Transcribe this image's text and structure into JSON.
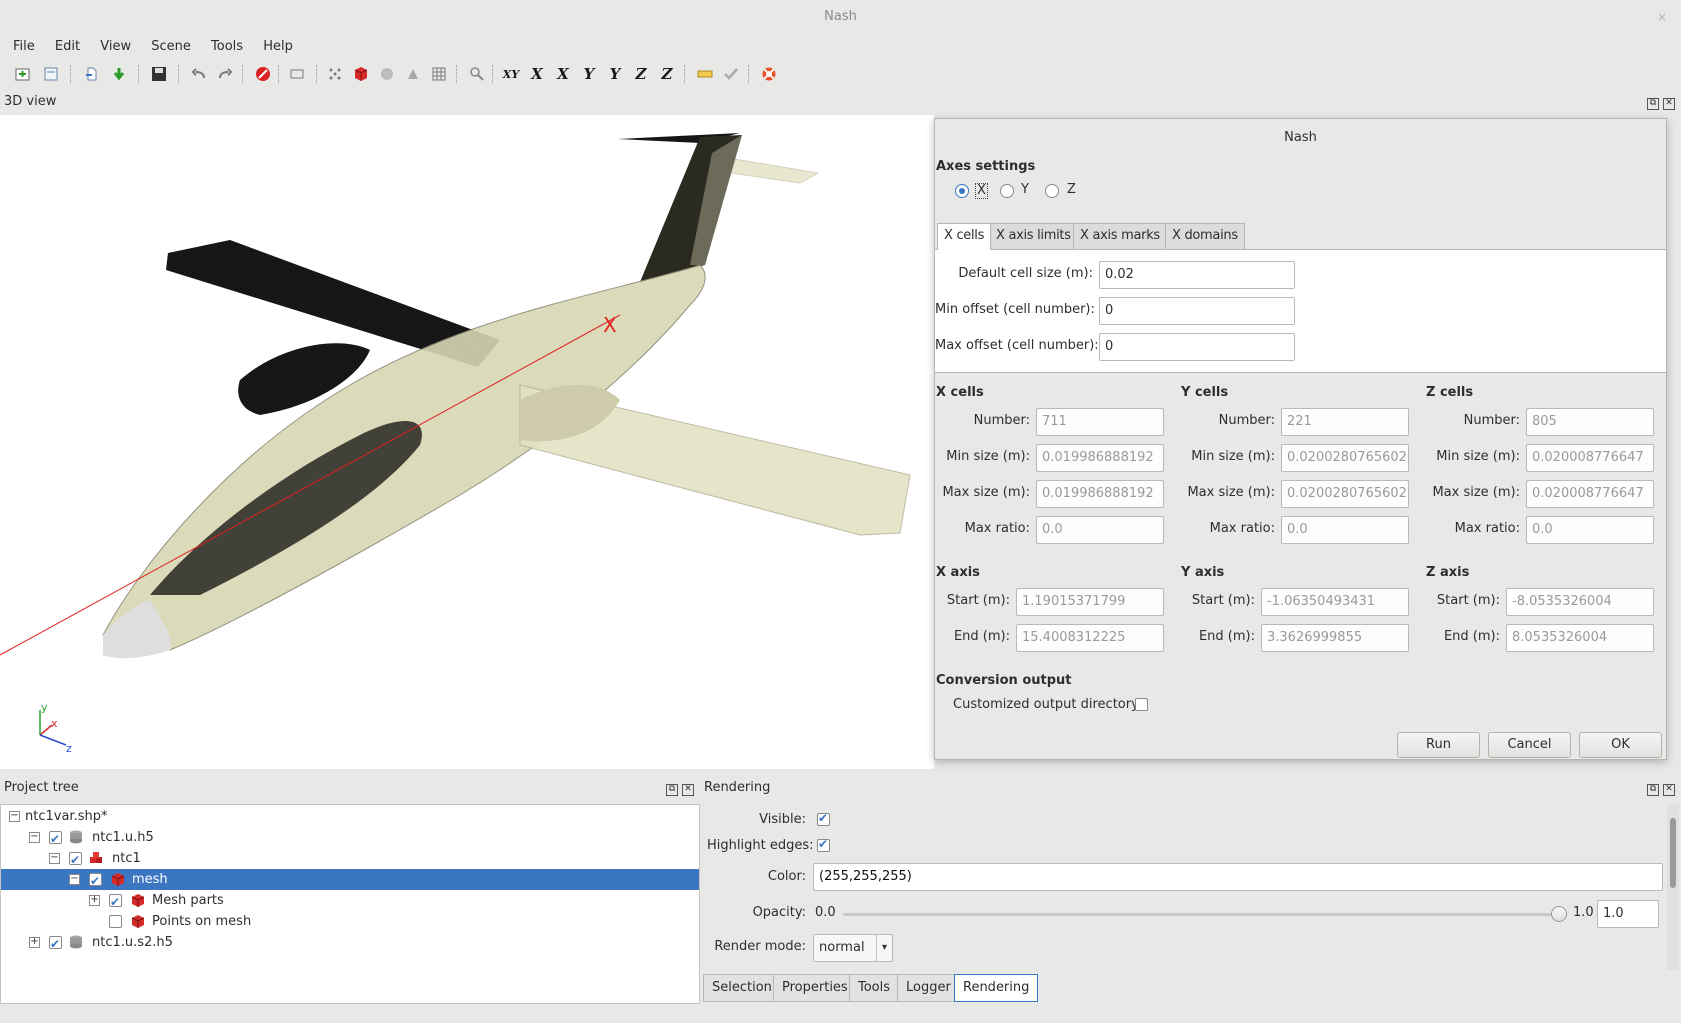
{
  "window": {
    "title": "Nash",
    "close_glyph": "×"
  },
  "menu": [
    "File",
    "Edit",
    "View",
    "Scene",
    "Tools",
    "Help"
  ],
  "toolbar": {
    "axis_buttons": [
      "XY",
      "X",
      "X",
      "Y",
      "Y",
      "Z",
      "Z"
    ]
  },
  "view3d": {
    "title": "3D view",
    "marker_label": "X",
    "triad": {
      "x": "x",
      "y": "y",
      "z": "z"
    }
  },
  "dialog": {
    "title": "Nash",
    "axes_settings_label": "Axes settings",
    "radios": [
      {
        "label": "X",
        "selected": true
      },
      {
        "label": "Y",
        "selected": false
      },
      {
        "label": "Z",
        "selected": false
      }
    ],
    "tabs": [
      "X cells",
      "X axis limits",
      "X axis marks",
      "X domains"
    ],
    "active_tab": "X cells",
    "cell_form": {
      "default_cell_size_label": "Default cell size (m):",
      "default_cell_size_value": "0.02",
      "min_offset_label": "Min offset (cell number):",
      "min_offset_value": "0",
      "max_offset_label": "Max offset (cell number):",
      "max_offset_value": "0"
    },
    "cells": [
      {
        "title": "X cells",
        "number_label": "Number:",
        "number": "711",
        "min_size_label": "Min size (m):",
        "min_size": "0.019986888192",
        "max_size_label": "Max size (m):",
        "max_size": "0.019986888192",
        "max_ratio_label": "Max ratio:",
        "max_ratio": "0.0"
      },
      {
        "title": "Y cells",
        "number_label": "Number:",
        "number": "221",
        "min_size_label": "Min size (m):",
        "min_size": "0.0200280765602",
        "max_size_label": "Max size (m):",
        "max_size": "0.0200280765602",
        "max_ratio_label": "Max ratio:",
        "max_ratio": "0.0"
      },
      {
        "title": "Z cells",
        "number_label": "Number:",
        "number": "805",
        "min_size_label": "Min size (m):",
        "min_size": "0.020008776647",
        "max_size_label": "Max size (m):",
        "max_size": "0.020008776647",
        "max_ratio_label": "Max ratio:",
        "max_ratio": "0.0"
      }
    ],
    "axes": [
      {
        "title": "X axis",
        "start_label": "Start (m):",
        "start": "1.19015371799",
        "end_label": "End (m):",
        "end": "15.4008312225"
      },
      {
        "title": "Y axis",
        "start_label": "Start (m):",
        "start": "-1.06350493431",
        "end_label": "End (m):",
        "end": "3.3626999855"
      },
      {
        "title": "Z axis",
        "start_label": "Start (m):",
        "start": "-8.0535326004",
        "end_label": "End (m):",
        "end": "8.0535326004"
      }
    ],
    "conversion_output_label": "Conversion output",
    "custom_dir_label": "Customized output directory:",
    "custom_dir_checked": false,
    "buttons": {
      "run": "Run",
      "cancel": "Cancel",
      "ok": "OK"
    }
  },
  "project_tree": {
    "title": "Project tree",
    "items": [
      {
        "label": "ntc1var.shp*",
        "expander": "−",
        "checked": null
      },
      {
        "label": "ntc1.u.h5",
        "expander": "−",
        "checked": true
      },
      {
        "label": "ntc1",
        "expander": "−",
        "checked": true
      },
      {
        "label": "mesh",
        "expander": "−",
        "checked": true,
        "selected": true
      },
      {
        "label": "Mesh parts",
        "expander": "+",
        "checked": true
      },
      {
        "label": "Points on mesh",
        "expander": "",
        "checked": false
      },
      {
        "label": "ntc1.u.s2.h5",
        "expander": "+",
        "checked": true
      }
    ]
  },
  "rendering": {
    "title": "Rendering",
    "visible_label": "Visible:",
    "visible": true,
    "highlight_label": "Highlight edges:",
    "highlight": true,
    "color_label": "Color:",
    "color_value": "(255,255,255)",
    "opacity_label": "Opacity:",
    "opacity_min": "0.0",
    "opacity_max": "1.0",
    "opacity_value": "1.0",
    "opacity_fraction": 1.0,
    "render_mode_label": "Render mode:",
    "render_mode_value": "normal"
  },
  "bottom_tabs": [
    "Selection",
    "Properties",
    "Tools",
    "Logger",
    "Rendering"
  ],
  "active_bottom_tab": "Rendering",
  "colors": {
    "accent": "#3b76c2",
    "mesh_red": "#d42a2a",
    "fuselage": "#e4e2c4"
  }
}
